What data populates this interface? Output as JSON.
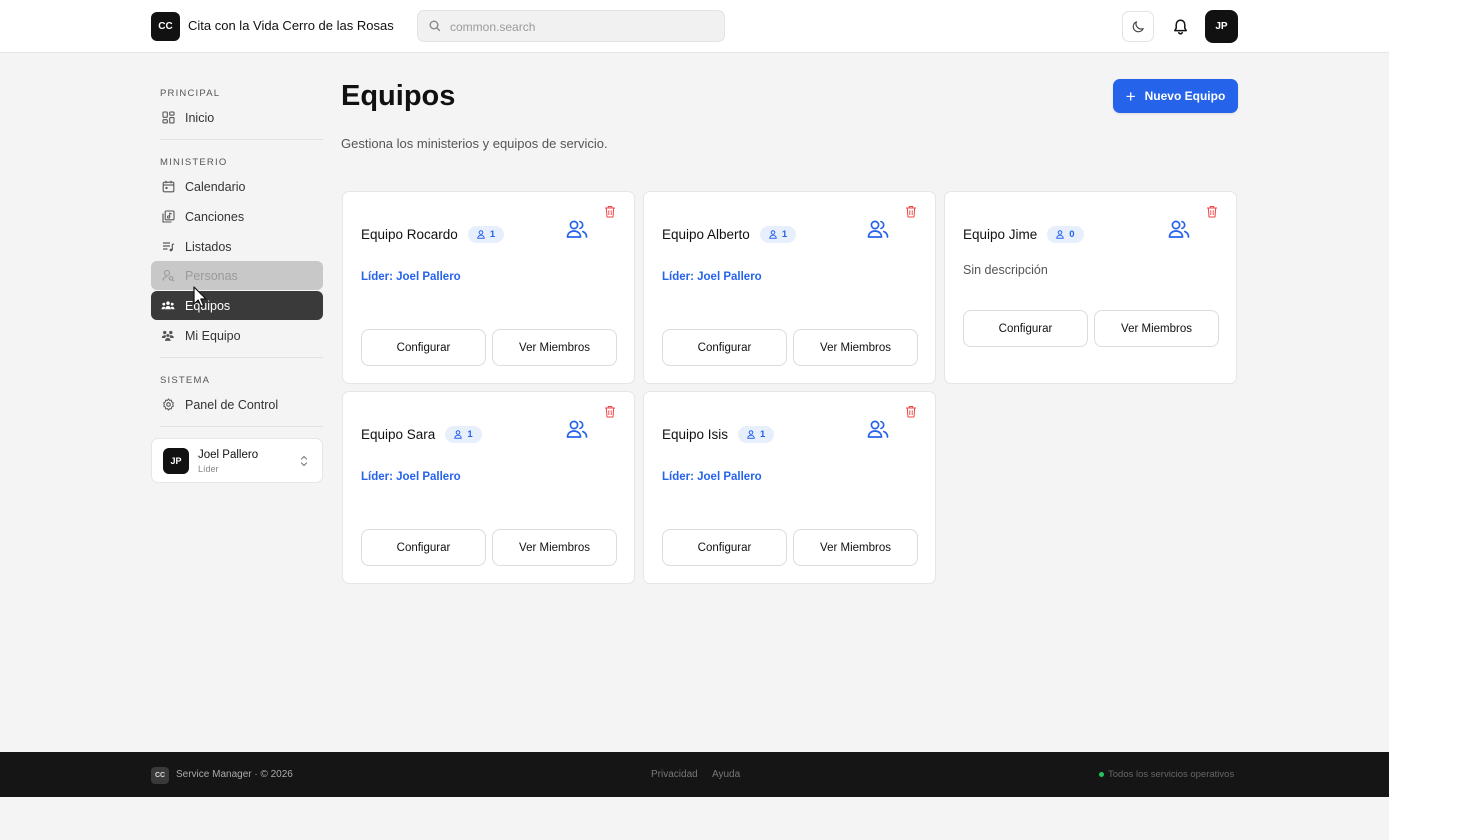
{
  "header": {
    "logo_initials": "CC",
    "app_name": "Cita con la Vida Cerro de las Rosas",
    "search_placeholder": "common.search",
    "avatar_initials": "JP"
  },
  "sidebar": {
    "sections": {
      "principal": "PRINCIPAL",
      "ministerio": "MINISTERIO",
      "sistema": "SISTEMA"
    },
    "items": {
      "inicio": "Inicio",
      "calendario": "Calendario",
      "canciones": "Canciones",
      "listados": "Listados",
      "personas": "Personas",
      "equipos": "Equipos",
      "mi_equipo": "Mi Equipo",
      "panel": "Panel de Control"
    },
    "active_item": "Equipos",
    "hovered_item": "Personas",
    "user": {
      "initials": "JP",
      "name": "Joel Pallero",
      "role": "Líder"
    }
  },
  "main": {
    "title": "Equipos",
    "subtitle": "Gestiona los ministerios y equipos de servicio.",
    "new_button": "Nuevo Equipo",
    "new_button_icon": "+",
    "teams": [
      {
        "name": "Equipo Rocardo",
        "members": "1",
        "leader": "Líder: Joel Pallero",
        "configure": "Configurar",
        "view": "Ver Miembros"
      },
      {
        "name": "Equipo Alberto",
        "members": "1",
        "leader": "Líder: Joel Pallero",
        "configure": "Configurar",
        "view": "Ver Miembros"
      },
      {
        "name": "Equipo Jime",
        "members": "0",
        "description": "Sin descripción",
        "configure": "Configurar",
        "view": "Ver Miembros"
      },
      {
        "name": "Equipo Sara",
        "members": "1",
        "leader": "Líder: Joel Pallero",
        "configure": "Configurar",
        "view": "Ver Miembros"
      },
      {
        "name": "Equipo Isis",
        "members": "1",
        "leader": "Líder: Joel Pallero",
        "configure": "Configurar",
        "view": "Ver Miembros"
      }
    ]
  },
  "footer": {
    "logo_initials": "CC",
    "brand": "Service Manager · © 2026",
    "privacy": "Privacidad",
    "help": "Ayuda",
    "status": "Todos los servicios operativos"
  },
  "colors": {
    "accent": "#2563eb",
    "danger": "#ef4444",
    "status_ok": "#22c55e",
    "sidebar_active": "#3a3a3a",
    "footer_bg": "#151515"
  }
}
